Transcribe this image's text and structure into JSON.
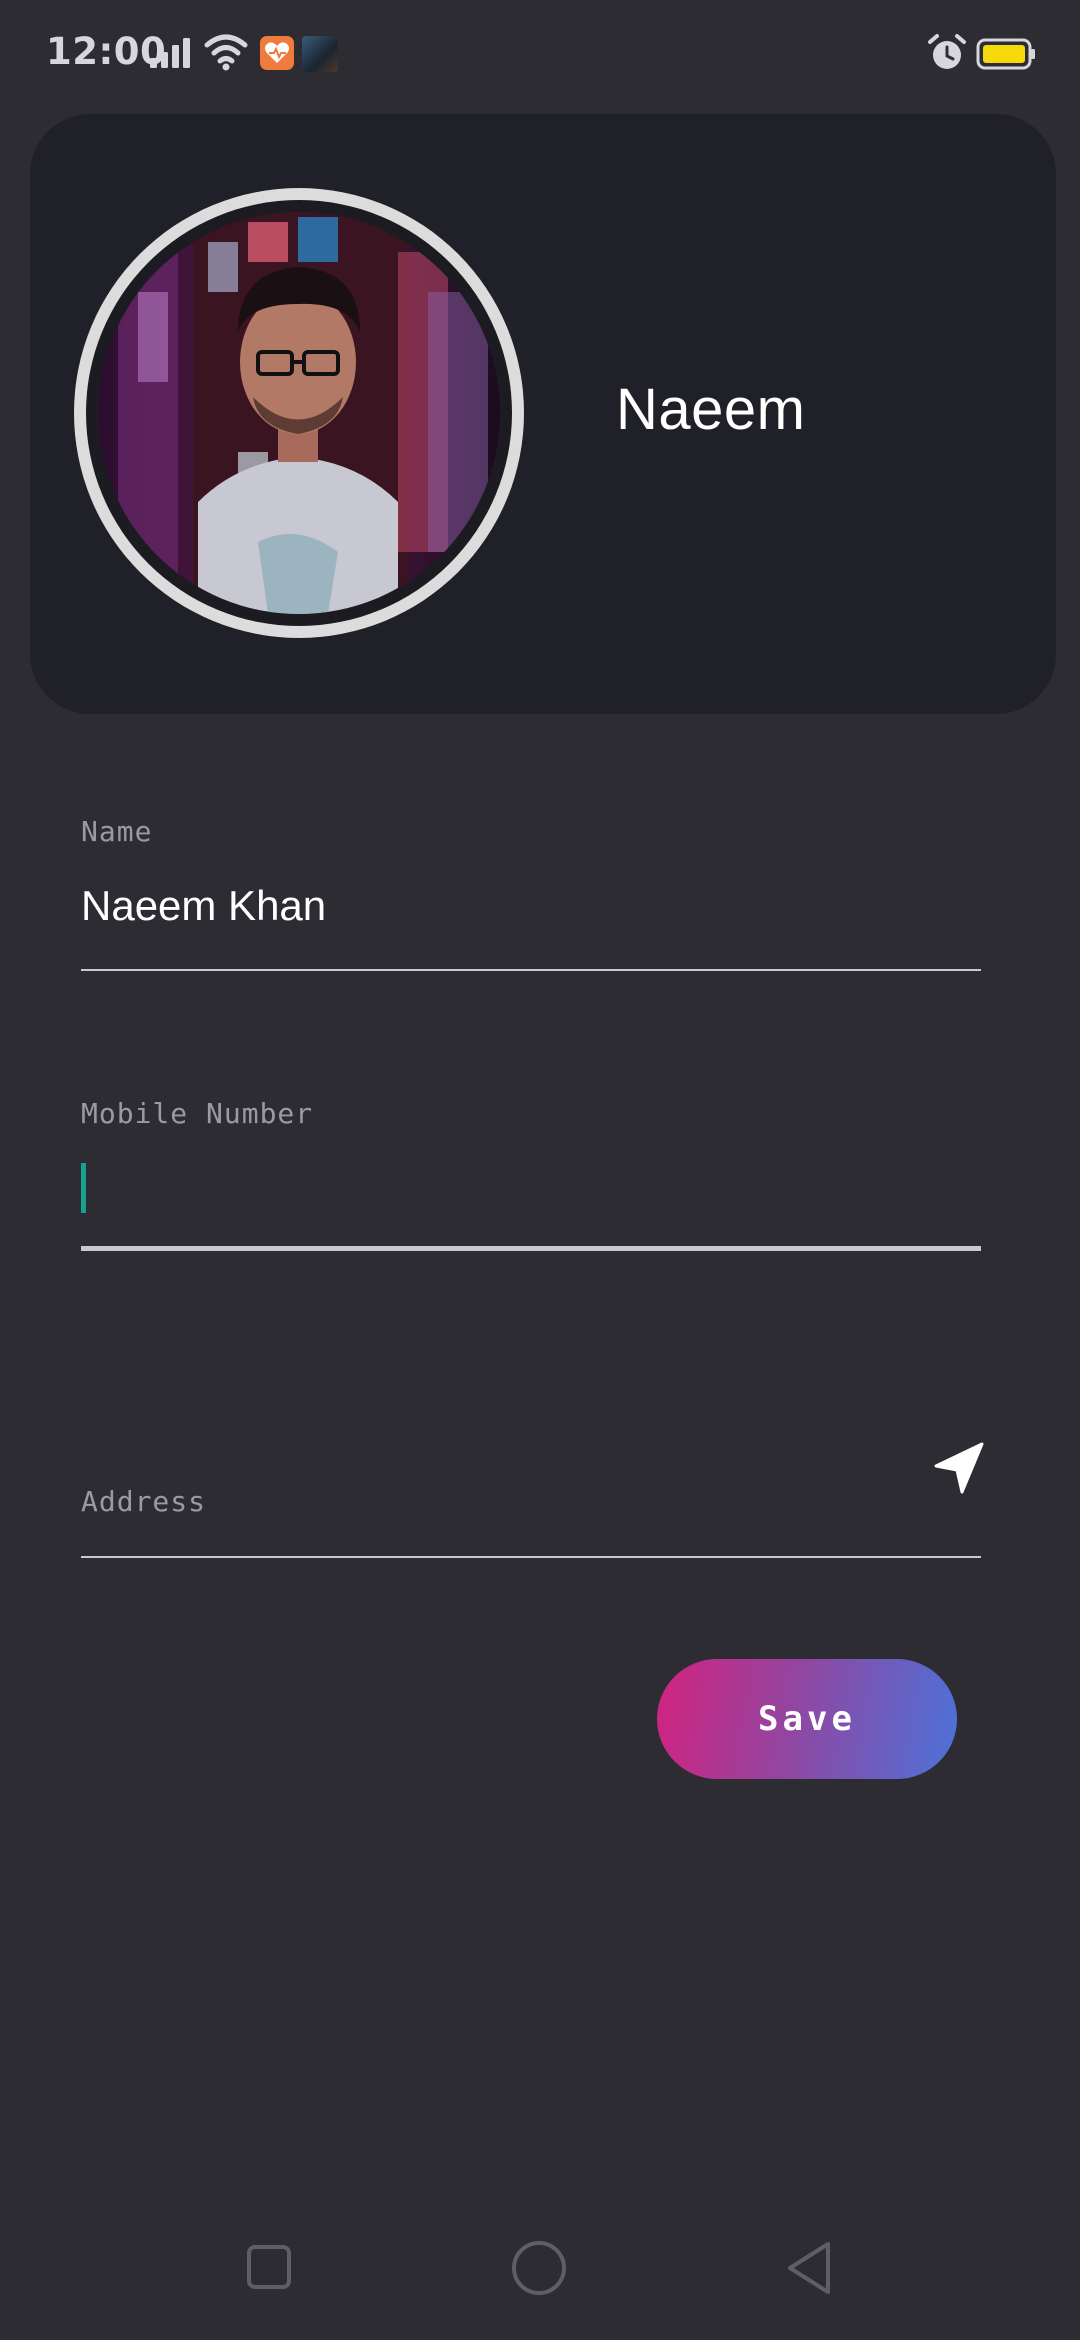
{
  "status_bar": {
    "time": "12:00",
    "icons": [
      "signal-icon",
      "wifi-icon",
      "health-app-icon",
      "gallery-app-icon",
      "alarm-icon",
      "battery-icon"
    ],
    "battery_color": "#f5d90a"
  },
  "profile": {
    "display_name": "Naeem",
    "avatar": "profile-photo"
  },
  "form": {
    "name": {
      "label": "Name",
      "value": "Naeem Khan"
    },
    "mobile": {
      "label": "Mobile Number",
      "value": ""
    },
    "address": {
      "label": "Address",
      "value": "",
      "action_icon": "navigation-arrow-icon"
    },
    "save_label": "Save"
  },
  "colors": {
    "background": "#2d2c33",
    "card": "#202028",
    "cursor": "#1aa08f",
    "save_gradient_start": "#d2237e",
    "save_gradient_end": "#4c72d9"
  },
  "nav_bar": {
    "icons": [
      "recents-square-icon",
      "home-circle-icon",
      "back-triangle-icon"
    ]
  }
}
